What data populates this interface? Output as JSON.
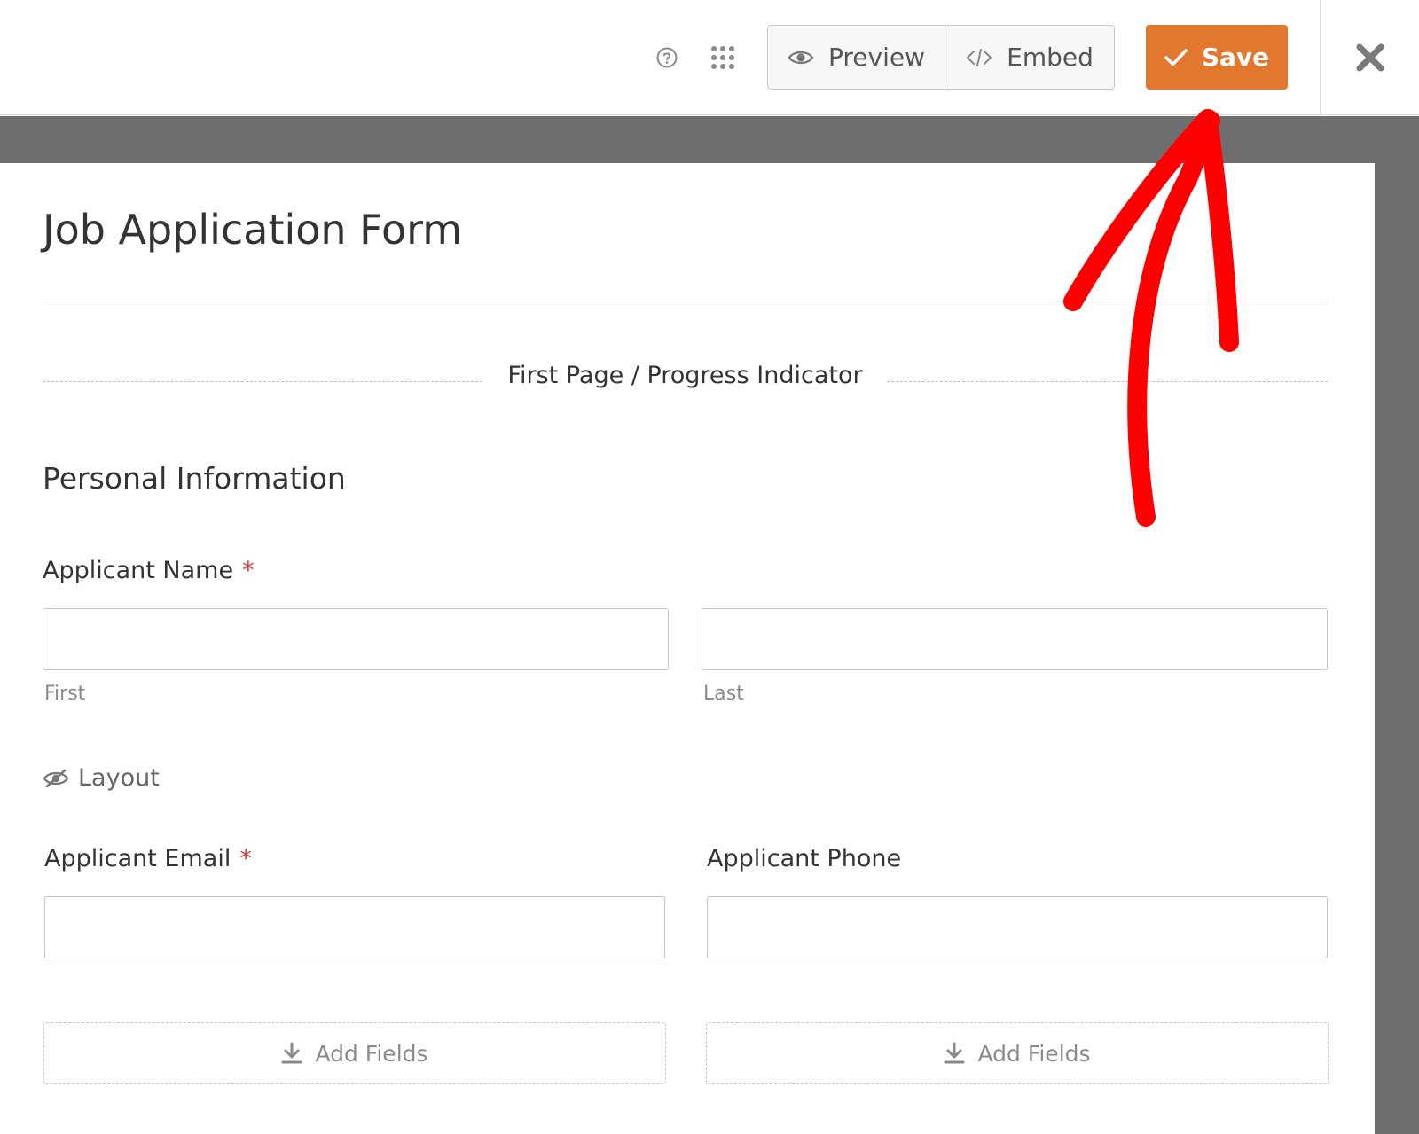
{
  "toolbar": {
    "help_icon": "help-circle-icon",
    "apps_icon": "grid-dots-icon",
    "preview_label": "Preview",
    "embed_label": "Embed",
    "save_label": "Save",
    "close_icon": "close-x-icon"
  },
  "form": {
    "title": "Job Application Form",
    "page_break_label": "First Page / Progress Indicator",
    "section_heading": "Personal Information",
    "name_field": {
      "label": "Applicant Name",
      "required_mark": "*",
      "first_sublabel": "First",
      "last_sublabel": "Last"
    },
    "layout_label": "Layout",
    "email_field": {
      "label": "Applicant Email",
      "required_mark": "*"
    },
    "phone_field": {
      "label": "Applicant Phone"
    },
    "add_fields_left": "Add Fields",
    "add_fields_right": "Add Fields"
  },
  "colors": {
    "save_accent": "#e27730",
    "required": "#d63638",
    "canvas_bg": "#6e6e6e",
    "annotation_arrow": "#ff0000"
  }
}
